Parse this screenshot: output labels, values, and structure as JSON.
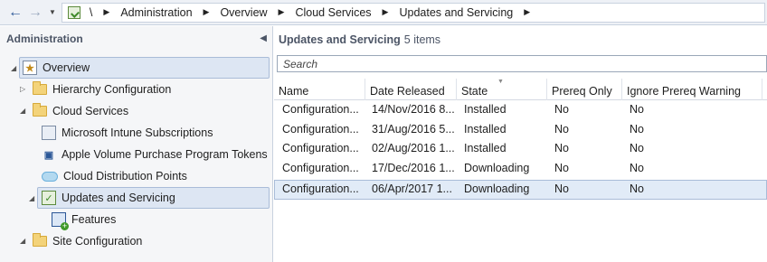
{
  "breadcrumb": {
    "root": "\\",
    "items": [
      "Administration",
      "Overview",
      "Cloud Services",
      "Updates and Servicing"
    ]
  },
  "sidebar": {
    "title": "Administration",
    "items": [
      {
        "label": "Overview",
        "icon": "overview-icon"
      },
      {
        "label": "Hierarchy Configuration",
        "icon": "folder-icon"
      },
      {
        "label": "Cloud Services",
        "icon": "folder-icon"
      },
      {
        "label": "Microsoft Intune Subscriptions",
        "icon": "intune-icon"
      },
      {
        "label": "Apple Volume Purchase Program Tokens",
        "icon": "apple-vpp-icon"
      },
      {
        "label": "Cloud Distribution Points",
        "icon": "cloud-icon"
      },
      {
        "label": "Updates and Servicing",
        "icon": "updates-icon"
      },
      {
        "label": "Features",
        "icon": "features-icon"
      },
      {
        "label": "Site Configuration",
        "icon": "folder-icon"
      }
    ]
  },
  "main": {
    "title": "Updates and Servicing",
    "count": "5 items",
    "search_placeholder": "Search",
    "columns": [
      "Name",
      "Date Released",
      "State",
      "Prereq Only",
      "Ignore Prereq Warning"
    ],
    "rows": [
      {
        "name": "Configuration...",
        "date": "14/Nov/2016 8...",
        "state": "Installed",
        "prereq": "No",
        "ignore": "No"
      },
      {
        "name": "Configuration...",
        "date": "31/Aug/2016 5...",
        "state": "Installed",
        "prereq": "No",
        "ignore": "No"
      },
      {
        "name": "Configuration...",
        "date": "02/Aug/2016 1...",
        "state": "Installed",
        "prereq": "No",
        "ignore": "No"
      },
      {
        "name": "Configuration...",
        "date": "17/Dec/2016 1...",
        "state": "Downloading",
        "prereq": "No",
        "ignore": "No"
      },
      {
        "name": "Configuration...",
        "date": "06/Apr/2017 1...",
        "state": "Downloading",
        "prereq": "No",
        "ignore": "No"
      }
    ]
  },
  "colors": {
    "accent": "#2b5797",
    "selection": "#e1ebf7",
    "selection_border": "#a9bcd8"
  }
}
